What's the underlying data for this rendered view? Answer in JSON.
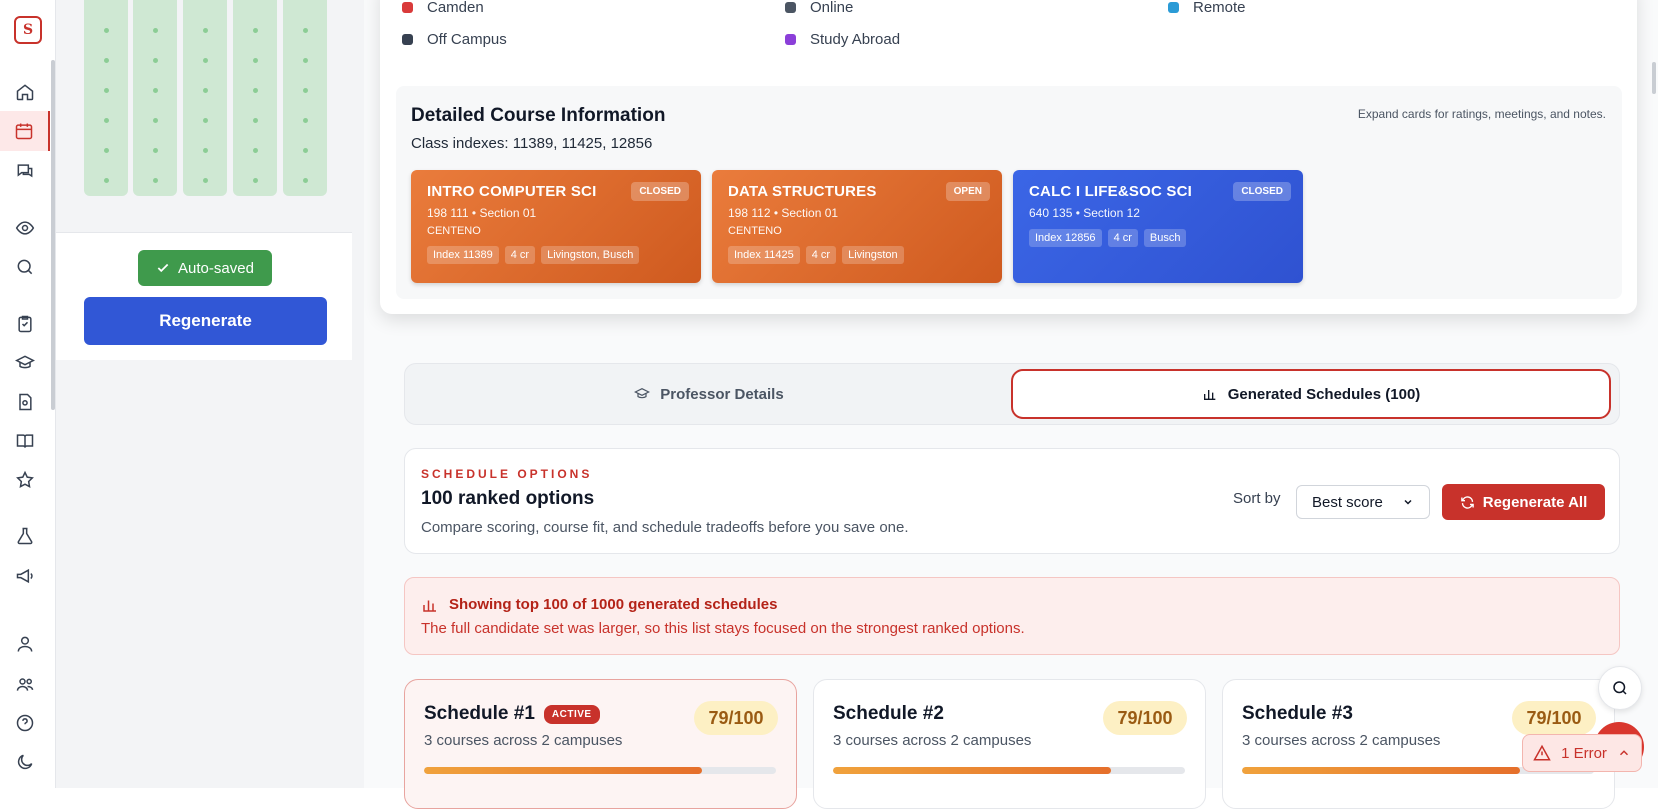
{
  "app": {
    "logo_letter": "S"
  },
  "legend": [
    {
      "label": "Camden",
      "color": "#d93a3a"
    },
    {
      "label": "Online",
      "color": "#4b5563"
    },
    {
      "label": "Remote",
      "color": "#2b9bd6"
    },
    {
      "label": "Off Campus",
      "color": "#374151"
    },
    {
      "label": "Study Abroad",
      "color": "#8b3fd9"
    }
  ],
  "left_panel": {
    "autosaved_label": "Auto-saved",
    "regenerate_label": "Regenerate"
  },
  "details": {
    "title": "Detailed Course Information",
    "indexes": "Class indexes: 11389, 11425, 12856",
    "hint": "Expand cards for ratings, meetings, and notes."
  },
  "courses": [
    {
      "name": "INTRO COMPUTER SCI",
      "status": "CLOSED",
      "code_section": "198 111 • Section 01",
      "professor": "CENTENO",
      "tags": [
        "Index 11389",
        "4 cr",
        "Livingston, Busch"
      ]
    },
    {
      "name": "DATA STRUCTURES",
      "status": "OPEN",
      "code_section": "198 112 • Section 01",
      "professor": "CENTENO",
      "tags": [
        "Index 11425",
        "4 cr",
        "Livingston"
      ]
    },
    {
      "name": "CALC I LIFE&SOC SCI",
      "status": "CLOSED",
      "code_section": "640 135 • Section 12",
      "professor": "",
      "tags": [
        "Index 12856",
        "4 cr",
        "Busch"
      ]
    }
  ],
  "tabs": {
    "professor": "Professor Details",
    "schedules": "Generated Schedules (100)"
  },
  "options": {
    "eyebrow": "SCHEDULE OPTIONS",
    "title": "100 ranked options",
    "subtitle": "Compare scoring, course fit, and schedule tradeoffs before you save one.",
    "sort_label": "Sort by",
    "sort_value": "Best score",
    "regen_all_label": "Regenerate All"
  },
  "alert": {
    "title": "Showing top 100 of 1000 generated schedules",
    "body": "The full candidate set was larger, so this list stays focused on the strongest ranked options."
  },
  "schedules": [
    {
      "title": "Schedule #1",
      "badge": "ACTIVE",
      "subtitle": "3 courses across 2 campuses",
      "score": "79/100",
      "progress": 0.79
    },
    {
      "title": "Schedule #2",
      "badge": "",
      "subtitle": "3 courses across 2 campuses",
      "score": "79/100",
      "progress": 0.79
    },
    {
      "title": "Schedule #3",
      "badge": "",
      "subtitle": "3 courses across 2 campuses",
      "score": "79/100",
      "progress": 0.79
    }
  ],
  "error_pill": {
    "label": "1 Error"
  }
}
